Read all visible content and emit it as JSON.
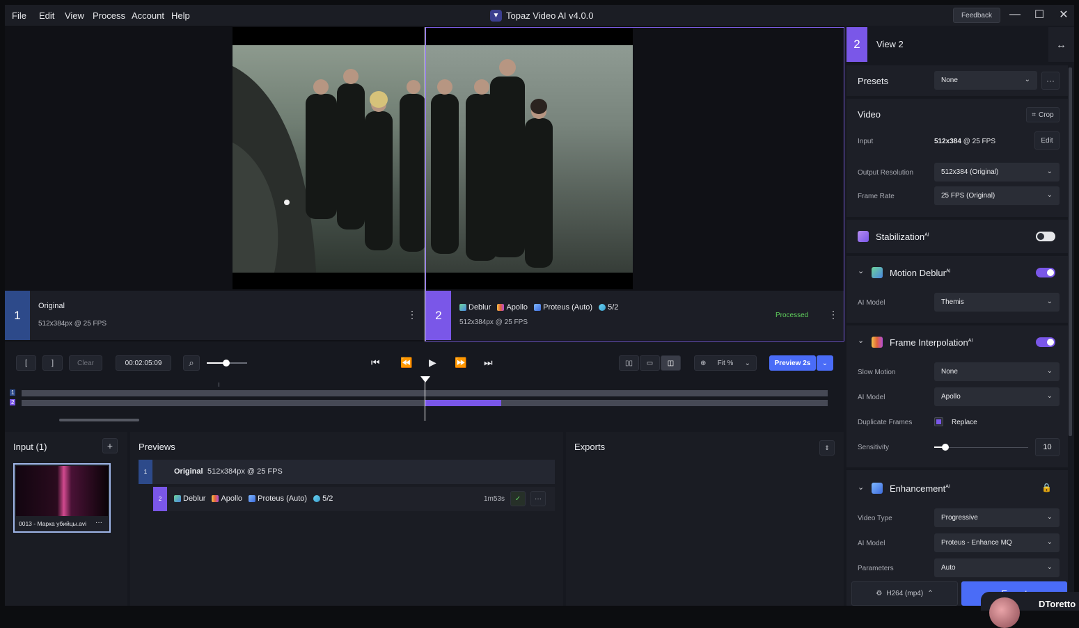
{
  "menu": [
    "File",
    "Edit",
    "View",
    "Process",
    "Account",
    "Help"
  ],
  "app": {
    "title": "Topaz Video AI  v4.0.0",
    "feedback": "Feedback"
  },
  "views": {
    "left": {
      "num": "1",
      "name": "Original",
      "meta": "512x384px @ 25 FPS"
    },
    "right": {
      "num": "2",
      "deblur": "Deblur",
      "apollo": "Apollo",
      "proteus": "Proteus (Auto)",
      "ratio": "5/2",
      "meta": "512x384px @ 25 FPS",
      "status": "Processed"
    }
  },
  "transport": {
    "in": "[",
    "out": "]",
    "clear": "Clear",
    "timecode": "00:02:05:09",
    "zoom": "Fit %",
    "preview": "Preview 2s",
    "track1": "1",
    "track2": "2",
    "progress": 0.095
  },
  "input": {
    "title": "Input (1)",
    "add": "+",
    "file": "0013 - Марка убийцы.avi",
    "more": "···"
  },
  "previews": {
    "title": "Previews",
    "row1": {
      "num": "1",
      "name": "Original",
      "meta": "512x384px @ 25 FPS"
    },
    "row2": {
      "num": "2",
      "deblur": "Deblur",
      "apollo": "Apollo",
      "proteus": "Proteus (Auto)",
      "ratio": "5/2",
      "time": "1m53s",
      "check": "✓",
      "more": "···"
    }
  },
  "exports": {
    "title": "Exports"
  },
  "right": {
    "num": "2",
    "view": "View 2",
    "presets": "Presets",
    "preset_val": "None",
    "video": "Video",
    "crop": "Crop",
    "input_lbl": "Input",
    "input_res": "512x384",
    "input_fps": "@ 25 FPS",
    "edit": "Edit",
    "outres_lbl": "Output Resolution",
    "outres": "512x384 (Original)",
    "fr_lbl": "Frame Rate",
    "fr": "25 FPS (Original)",
    "stab": "Stabilization",
    "ai": "AI",
    "motion": "Motion Deblur",
    "md_model_lbl": "AI Model",
    "md_model": "Themis",
    "fi": "Frame Interpolation",
    "slow_lbl": "Slow Motion",
    "slow": "None",
    "fi_model_lbl": "AI Model",
    "fi_model": "Apollo",
    "dup_lbl": "Duplicate Frames",
    "dup": "Replace",
    "sens_lbl": "Sensitivity",
    "sens": "10",
    "sens_level": 0.12,
    "enh": "Enhancement",
    "vt_lbl": "Video Type",
    "vt": "Progressive",
    "enh_model_lbl": "AI Model",
    "enh_model": "Proteus - Enhance MQ",
    "param_lbl": "Parameters",
    "param": "Auto",
    "codec": "H264 (mp4)",
    "export": "Export",
    "user": "DToretto"
  },
  "colors": {
    "accent": "#6e4ff0",
    "active": "#7a57e8",
    "blue": "#4a6cf7"
  }
}
